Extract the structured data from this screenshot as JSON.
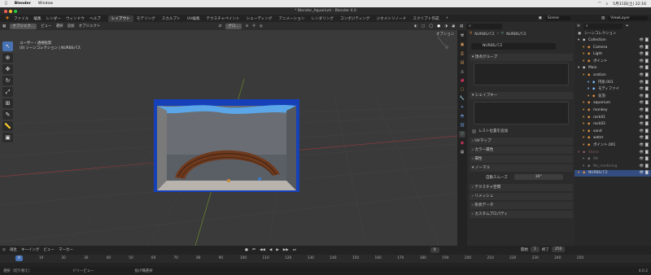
{
  "mac_menu": {
    "apple": "",
    "items": [
      "Blender",
      "Window"
    ],
    "right_time": "5月31日(土) 22:16"
  },
  "window_title": "* Blender_Aquarium - Blender 4.0",
  "menubar": {
    "menus": [
      "ファイル",
      "編集",
      "レンダー",
      "ウィンドウ",
      "ヘルプ"
    ],
    "workspaces": [
      "レイアウト",
      "モデリング",
      "スカルプト",
      "UV編集",
      "テクスチャペイント",
      "シェーディング",
      "アニメーション",
      "レンダリング",
      "コンポジティング",
      "ジオメトリノード",
      "スクリプト作成",
      "+"
    ],
    "active_workspace": "レイアウト",
    "scene": "Scene",
    "viewlayer": "ViewLayer"
  },
  "viewport": {
    "mode": "オブジェク...",
    "menus": [
      "ビュー",
      "選択",
      "追加",
      "オブジェクト"
    ],
    "transform": "グロ...",
    "options": "オプション",
    "info_line1": "ユーザー・透視投影",
    "info_line2": "(0) シーンコレクション | NURBSパス"
  },
  "timeline": {
    "menus": [
      "再生",
      "キーイング",
      "ビュー",
      "マーカー"
    ],
    "current_frame": "0",
    "start_label": "開始",
    "start": "1",
    "end_label": "終了",
    "end": "250",
    "ruler": [
      "0",
      "10",
      "20",
      "30",
      "40",
      "50",
      "60",
      "70",
      "80",
      "90",
      "100",
      "110",
      "120",
      "130",
      "140",
      "150",
      "160",
      "170",
      "180",
      "190",
      "200",
      "210",
      "220",
      "230",
      "240",
      "250"
    ]
  },
  "status": {
    "left": "選択（切り替え）",
    "mid": "ドリーピュー",
    "right": "投げ縄選択",
    "version": "4.0.2"
  },
  "properties": {
    "breadcrumb_a": "NURBSパス",
    "breadcrumb_b": "NURBSパス",
    "name_field": "NURBSパス",
    "sections": {
      "vertex_groups": "頂点グループ",
      "shape_keys": "シェイプキー",
      "rest_position": "レスト位置を追加",
      "uv_maps": "UVマップ",
      "color_attrs": "カラー属性",
      "attributes": "属性",
      "normals": "ノーマル",
      "auto_smooth": "自動スムーズ",
      "auto_smooth_val": "30°",
      "texture_space": "テクスチャ空間",
      "remesh": "リメッシュ",
      "geometry_data": "形状データ",
      "custom_props": "カスタムプロパティ"
    }
  },
  "outliner": {
    "header": "シーンコレクション",
    "rows": [
      {
        "label": "Collection",
        "indent": 1,
        "color": "#cccccc"
      },
      {
        "label": "Camera",
        "indent": 2,
        "color": "#e09040"
      },
      {
        "label": "Light",
        "indent": 2,
        "color": "#e09040"
      },
      {
        "label": "ポイント",
        "indent": 2,
        "color": "#e09040"
      },
      {
        "label": "Main",
        "indent": 1,
        "color": "#cccccc"
      },
      {
        "label": "aration",
        "indent": 2,
        "color": "#e09040"
      },
      {
        "label": "円形.001",
        "indent": 3,
        "color": "#7fbfff"
      },
      {
        "label": "モディファイ",
        "indent": 3,
        "color": "#7fbfff"
      },
      {
        "label": "気泡",
        "indent": 3,
        "color": "#e09040"
      },
      {
        "label": "aquarium",
        "indent": 2,
        "color": "#e09040"
      },
      {
        "label": "monkey",
        "indent": 2,
        "color": "#e09040"
      },
      {
        "label": "rock01",
        "indent": 2,
        "color": "#e09040"
      },
      {
        "label": "rock02",
        "indent": 2,
        "color": "#e09040"
      },
      {
        "label": "sand",
        "indent": 2,
        "color": "#e09040"
      },
      {
        "label": "water",
        "indent": 2,
        "color": "#e09040"
      },
      {
        "label": "ポイント.001",
        "indent": 2,
        "color": "#e09040"
      },
      {
        "label": "Stone",
        "indent": 1,
        "color": "#8a5a5a"
      },
      {
        "label": "Alt",
        "indent": 2,
        "color": "#777777"
      },
      {
        "label": "No_rendering",
        "indent": 2,
        "color": "#777777"
      },
      {
        "label": "NURBSパス",
        "indent": 1,
        "color": "#e09040"
      }
    ]
  }
}
